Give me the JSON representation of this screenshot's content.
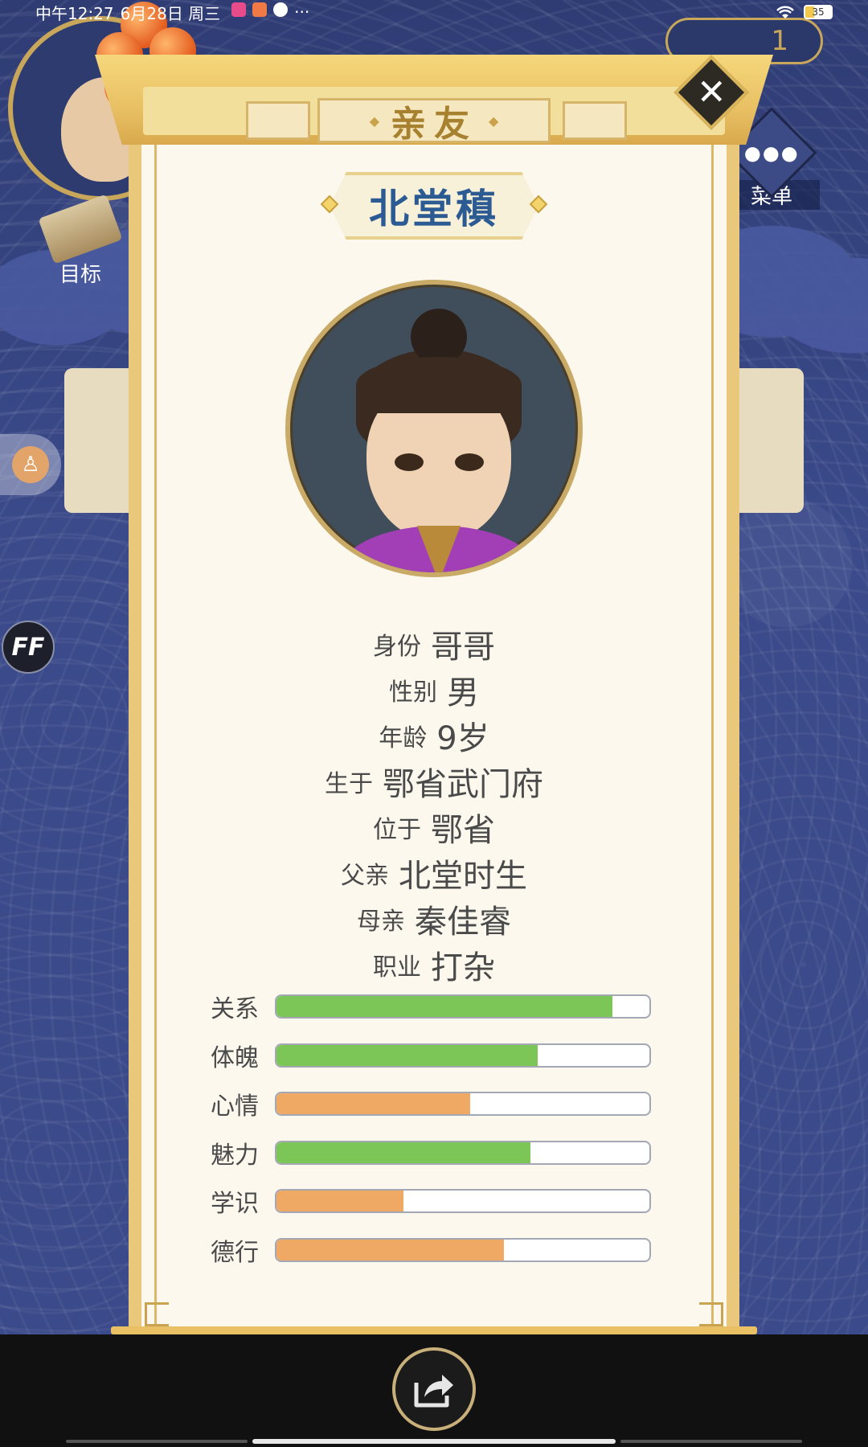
{
  "status_bar": {
    "time": "中午12:27",
    "date": "6月28日 周三",
    "more": "···",
    "battery": "35"
  },
  "hud": {
    "gold_value": "1",
    "target_label": "目标",
    "menu_label": "菜单",
    "ff_label": "FF"
  },
  "dialog": {
    "title": "亲友",
    "close_icon": "close-icon"
  },
  "character": {
    "name": "北堂稹",
    "info": [
      {
        "key": "身份",
        "value": "哥哥"
      },
      {
        "key": "性别",
        "value": "男"
      },
      {
        "key": "年龄",
        "value": "9岁"
      },
      {
        "key": "生于",
        "value": "鄂省武门府"
      },
      {
        "key": "位于",
        "value": "鄂省"
      },
      {
        "key": "父亲",
        "value": "北堂时生"
      },
      {
        "key": "母亲",
        "value": "秦佳睿"
      },
      {
        "key": "职业",
        "value": "打杂"
      }
    ],
    "stats": [
      {
        "label": "关系",
        "level": 0.9,
        "color": "#7bc657"
      },
      {
        "label": "体魄",
        "level": 0.7,
        "color": "#7bc657"
      },
      {
        "label": "心情",
        "level": 0.52,
        "color": "#f0a865"
      },
      {
        "label": "魅力",
        "level": 0.68,
        "color": "#7bc657"
      },
      {
        "label": "学识",
        "level": 0.34,
        "color": "#f0a865"
      },
      {
        "label": "德行",
        "level": 0.61,
        "color": "#f0a865"
      }
    ]
  },
  "footer": {
    "share_icon": "share-icon"
  }
}
